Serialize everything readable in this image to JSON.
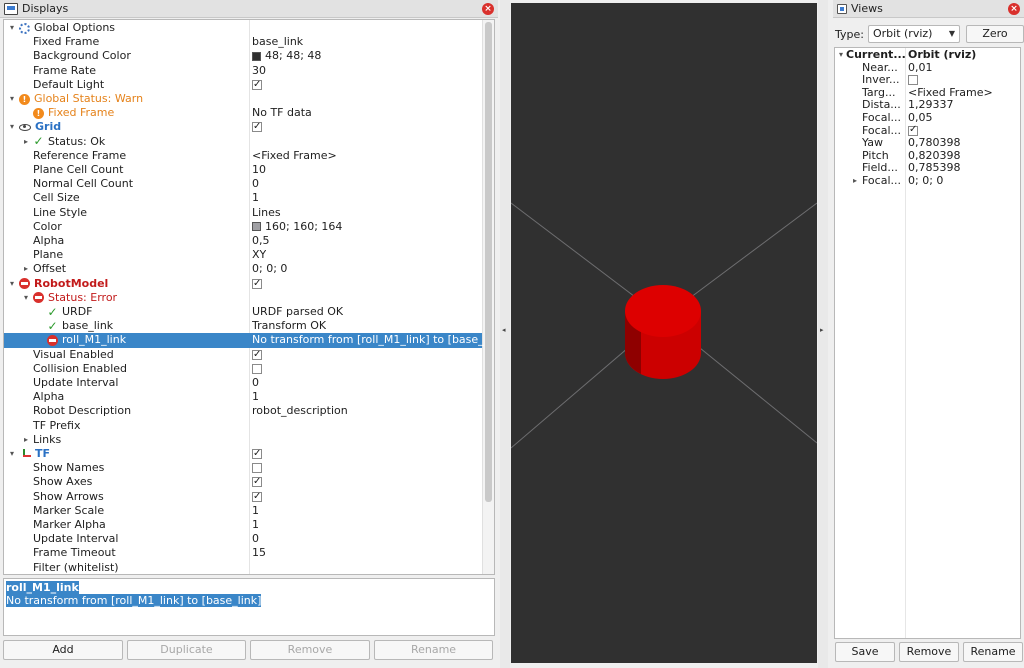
{
  "displays": {
    "title": "Displays",
    "rows": [
      {
        "label": "Global Options",
        "value": "",
        "indent": 0,
        "arrow": "▾",
        "icon": "gear",
        "style": ""
      },
      {
        "label": "Fixed Frame",
        "value": "base_link",
        "indent": 1,
        "arrow": "",
        "icon": "",
        "style": ""
      },
      {
        "label": "Background Color",
        "value": "48; 48; 48",
        "indent": 1,
        "arrow": "",
        "icon": "",
        "style": "",
        "swatch": "#303030"
      },
      {
        "label": "Frame Rate",
        "value": "30",
        "indent": 1,
        "arrow": "",
        "icon": "",
        "style": ""
      },
      {
        "label": "Default Light",
        "value": "",
        "indent": 1,
        "arrow": "",
        "icon": "",
        "style": "",
        "check": true
      },
      {
        "label": "Global Status: Warn",
        "value": "",
        "indent": 0,
        "arrow": "▾",
        "icon": "warn",
        "style": "orange"
      },
      {
        "label": "Fixed Frame",
        "value": "No TF data",
        "indent": 1,
        "arrow": "",
        "icon": "warn",
        "style": "orange"
      },
      {
        "label": "Grid",
        "value": "",
        "indent": 0,
        "arrow": "▾",
        "icon": "eye",
        "style": "blue",
        "check": true
      },
      {
        "label": "Status: Ok",
        "value": "",
        "indent": 1,
        "arrow": "▸",
        "icon": "ok",
        "style": ""
      },
      {
        "label": "Reference Frame",
        "value": "<Fixed Frame>",
        "indent": 1,
        "arrow": "",
        "icon": "",
        "style": ""
      },
      {
        "label": "Plane Cell Count",
        "value": "10",
        "indent": 1,
        "arrow": "",
        "icon": "",
        "style": ""
      },
      {
        "label": "Normal Cell Count",
        "value": "0",
        "indent": 1,
        "arrow": "",
        "icon": "",
        "style": ""
      },
      {
        "label": "Cell Size",
        "value": "1",
        "indent": 1,
        "arrow": "",
        "icon": "",
        "style": ""
      },
      {
        "label": "Line Style",
        "value": "Lines",
        "indent": 1,
        "arrow": "",
        "icon": "",
        "style": ""
      },
      {
        "label": "Color",
        "value": "160; 160; 164",
        "indent": 1,
        "arrow": "",
        "icon": "",
        "style": "",
        "swatch": "#a0a0a4"
      },
      {
        "label": "Alpha",
        "value": "0,5",
        "indent": 1,
        "arrow": "",
        "icon": "",
        "style": ""
      },
      {
        "label": "Plane",
        "value": "XY",
        "indent": 1,
        "arrow": "",
        "icon": "",
        "style": ""
      },
      {
        "label": "Offset",
        "value": "0; 0; 0",
        "indent": 1,
        "arrow": "▸",
        "icon": "",
        "style": ""
      },
      {
        "label": "RobotModel",
        "value": "",
        "indent": 0,
        "arrow": "▾",
        "icon": "err",
        "style": "red",
        "check": true
      },
      {
        "label": "Status: Error",
        "value": "",
        "indent": 1,
        "arrow": "▾",
        "icon": "err",
        "style": "redn"
      },
      {
        "label": "URDF",
        "value": "URDF parsed OK",
        "indent": 2,
        "arrow": "",
        "icon": "ok",
        "style": ""
      },
      {
        "label": "base_link",
        "value": "Transform OK",
        "indent": 2,
        "arrow": "",
        "icon": "ok",
        "style": ""
      },
      {
        "label": "roll_M1_link",
        "value": "No transform from [roll_M1_link] to [base_...",
        "indent": 2,
        "arrow": "",
        "icon": "err",
        "style": "",
        "selected": true
      },
      {
        "label": "Visual Enabled",
        "value": "",
        "indent": 1,
        "arrow": "",
        "icon": "",
        "style": "",
        "check": true
      },
      {
        "label": "Collision Enabled",
        "value": "",
        "indent": 1,
        "arrow": "",
        "icon": "",
        "style": "",
        "check": false
      },
      {
        "label": "Update Interval",
        "value": "0",
        "indent": 1,
        "arrow": "",
        "icon": "",
        "style": ""
      },
      {
        "label": "Alpha",
        "value": "1",
        "indent": 1,
        "arrow": "",
        "icon": "",
        "style": ""
      },
      {
        "label": "Robot Description",
        "value": "robot_description",
        "indent": 1,
        "arrow": "",
        "icon": "",
        "style": ""
      },
      {
        "label": "TF Prefix",
        "value": "",
        "indent": 1,
        "arrow": "",
        "icon": "",
        "style": ""
      },
      {
        "label": "Links",
        "value": "",
        "indent": 1,
        "arrow": "▸",
        "icon": "",
        "style": ""
      },
      {
        "label": "TF",
        "value": "",
        "indent": 0,
        "arrow": "▾",
        "icon": "axes",
        "style": "blue",
        "check": true
      },
      {
        "label": "Show Names",
        "value": "",
        "indent": 1,
        "arrow": "",
        "icon": "",
        "style": "",
        "check": false
      },
      {
        "label": "Show Axes",
        "value": "",
        "indent": 1,
        "arrow": "",
        "icon": "",
        "style": "",
        "check": true
      },
      {
        "label": "Show Arrows",
        "value": "",
        "indent": 1,
        "arrow": "",
        "icon": "",
        "style": "",
        "check": true
      },
      {
        "label": "Marker Scale",
        "value": "1",
        "indent": 1,
        "arrow": "",
        "icon": "",
        "style": ""
      },
      {
        "label": "Marker Alpha",
        "value": "1",
        "indent": 1,
        "arrow": "",
        "icon": "",
        "style": ""
      },
      {
        "label": "Update Interval",
        "value": "0",
        "indent": 1,
        "arrow": "",
        "icon": "",
        "style": ""
      },
      {
        "label": "Frame Timeout",
        "value": "15",
        "indent": 1,
        "arrow": "",
        "icon": "",
        "style": ""
      },
      {
        "label": "Filter (whitelist)",
        "value": "",
        "indent": 1,
        "arrow": "",
        "icon": "",
        "style": ""
      }
    ],
    "description": {
      "title": "roll_M1_link",
      "text": "No transform from [roll_M1_link] to [base_link]"
    },
    "buttons": {
      "add": "Add",
      "duplicate": "Duplicate",
      "remove": "Remove",
      "rename": "Rename"
    }
  },
  "views": {
    "title": "Views",
    "type_label": "Type:",
    "type_value": "Orbit (rviz)",
    "zero_label": "Zero",
    "rows": [
      {
        "label": "Current...",
        "value": "Orbit (rviz)",
        "indent": 0,
        "arrow": "▾",
        "bold": true
      },
      {
        "label": "Near...",
        "value": "0,01",
        "indent": 1,
        "arrow": ""
      },
      {
        "label": "Inver...",
        "value": "",
        "indent": 1,
        "arrow": "",
        "check": false
      },
      {
        "label": "Targ...",
        "value": "<Fixed Frame>",
        "indent": 1,
        "arrow": ""
      },
      {
        "label": "Dista...",
        "value": "1,29337",
        "indent": 1,
        "arrow": ""
      },
      {
        "label": "Focal...",
        "value": "0,05",
        "indent": 1,
        "arrow": ""
      },
      {
        "label": "Focal...",
        "value": "",
        "indent": 1,
        "arrow": "",
        "check": true
      },
      {
        "label": "Yaw",
        "value": "0,780398",
        "indent": 1,
        "arrow": ""
      },
      {
        "label": "Pitch",
        "value": "0,820398",
        "indent": 1,
        "arrow": ""
      },
      {
        "label": "Field...",
        "value": "0,785398",
        "indent": 1,
        "arrow": ""
      },
      {
        "label": "Focal...",
        "value": "0; 0; 0",
        "indent": 1,
        "arrow": "▸"
      }
    ],
    "buttons": {
      "save": "Save",
      "remove": "Remove",
      "rename": "Rename"
    }
  },
  "scene": {
    "background_color": "#303030",
    "grid_color": "#a0a0a4",
    "robot_color": "#cc0000"
  },
  "icons": {
    "displays_panel": "monitor-icon",
    "views_panel": "camera-icon",
    "close": "close-icon"
  }
}
